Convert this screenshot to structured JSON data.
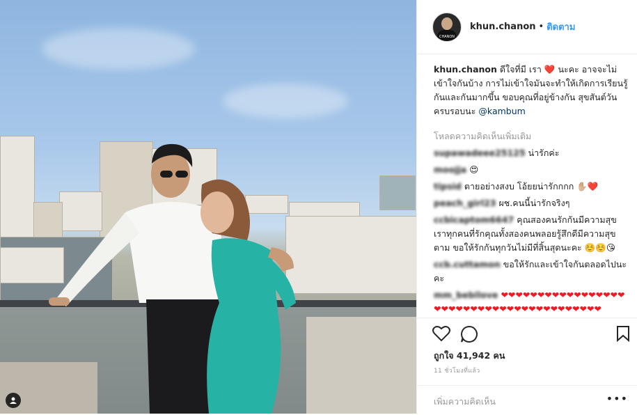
{
  "post": {
    "username": "khun.chanon",
    "follow_label": "ติดตาม",
    "separator": "•",
    "avatar_label": "CHANON",
    "caption_user": "khun.chanon",
    "caption_text": "ดีใจที่มี เรา",
    "caption_text2": "นะคะ อาจจะไม่เข้าใจกันบ้าง การไม่เข้าใจมันจะทำให้เกิดการเรียนรู้กันและกันมากขึ้น ขอบคุณที่อยู่ข้างกัน สุขสันต์วันครบรอบนะ",
    "caption_mention": "@kambum",
    "load_more": "โหลดความคิดเห็นเพิ่มเติม",
    "comments": [
      {
        "user": "supawadeee25125",
        "text": "น่ารักค่ะ",
        "emoji": ""
      },
      {
        "user": "moojja",
        "text": "",
        "emoji": "😍"
      },
      {
        "user": "tipsid",
        "text": "ตายอย่างสงบ โอ้ยยน่ารักกกก",
        "emoji": "✋🏼❤️"
      },
      {
        "user": "peach_girl23",
        "text": "ผช.คนนี้น่ารักจริงๆ",
        "emoji": ""
      },
      {
        "user": "ccbicaptom6647",
        "text": "คุณสองคนรักกันมีความสุข เราทุกคนที่รักคุณทั้งสองคนพลอยรู้สึกดีมีความสุขตาม ขอให้รักกันทุกวันไม่มีที่สิ้นสุดนะคะ",
        "emoji": "☺️☺️😘"
      },
      {
        "user": "ccb.cuttamon",
        "text": "ขอให้รักและเข้าใจกันตลอดไปนะคะ",
        "emoji": ""
      },
      {
        "user": "mm_bebilove",
        "text": "",
        "emoji": "❤❤❤❤❤❤❤❤❤❤❤❤❤❤❤❤❤❤❤❤❤❤❤❤❤❤❤❤❤❤❤❤❤❤❤❤❤❤❤❤"
      }
    ],
    "likes_label": "ถูกใจ 41,942 คน",
    "time_label": "11 ชั่วโมงที่แล้ว",
    "add_comment_placeholder": "เพิ่มความคิดเห็น",
    "options_label": "•••"
  },
  "icons": {
    "like": "heart-outline-icon",
    "comment": "comment-bubble-icon",
    "save": "bookmark-icon",
    "tagged": "user-tag-icon"
  },
  "colors": {
    "link": "#3897f0",
    "mention": "#003569",
    "heart": "#ed1c24",
    "muted": "#999999"
  }
}
